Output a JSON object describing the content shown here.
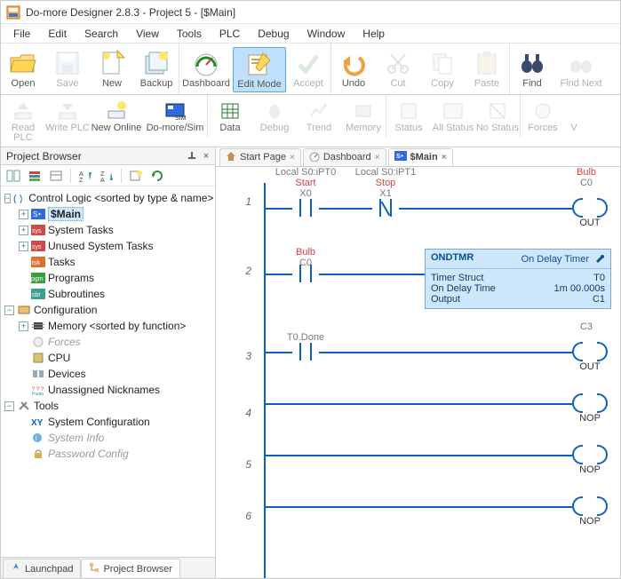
{
  "colors": {
    "accent": "#1060c0",
    "active_tab_bg": "#bfe0ff"
  },
  "titlebar": {
    "title": "Do-more Designer 2.8.3 - Project 5 - [$Main]"
  },
  "menu": {
    "items": [
      "File",
      "Edit",
      "Search",
      "View",
      "Tools",
      "PLC",
      "Debug",
      "Window",
      "Help"
    ]
  },
  "toolbar1": {
    "groups": [
      {
        "items": [
          {
            "id": "open",
            "label": "Open"
          },
          {
            "id": "save",
            "label": "Save",
            "disabled": true
          },
          {
            "id": "new",
            "label": "New"
          },
          {
            "id": "backup",
            "label": "Backup"
          }
        ]
      },
      {
        "items": [
          {
            "id": "dashboard",
            "label": "Dashboard"
          },
          {
            "id": "editmode",
            "label": "Edit Mode",
            "active": true
          },
          {
            "id": "accept",
            "label": "Accept",
            "disabled": true
          }
        ]
      },
      {
        "items": [
          {
            "id": "undo",
            "label": "Undo"
          },
          {
            "id": "cut",
            "label": "Cut",
            "disabled": true
          },
          {
            "id": "copy",
            "label": "Copy",
            "disabled": true
          },
          {
            "id": "paste",
            "label": "Paste",
            "disabled": true
          }
        ]
      },
      {
        "items": [
          {
            "id": "find",
            "label": "Find"
          },
          {
            "id": "findnext",
            "label": "Find Next",
            "disabled": true
          }
        ]
      }
    ]
  },
  "toolbar2": {
    "groups": [
      {
        "items": [
          {
            "id": "readplc",
            "label": "Read PLC",
            "disabled": true
          },
          {
            "id": "writeplc",
            "label": "Write PLC",
            "disabled": true
          },
          {
            "id": "newonline",
            "label": "New Online"
          },
          {
            "id": "domoresim",
            "label": "Do-more/Sim"
          }
        ]
      },
      {
        "items": [
          {
            "id": "data",
            "label": "Data"
          },
          {
            "id": "debug",
            "label": "Debug",
            "disabled": true
          },
          {
            "id": "trend",
            "label": "Trend",
            "disabled": true
          },
          {
            "id": "memory",
            "label": "Memory",
            "disabled": true
          }
        ]
      },
      {
        "items": [
          {
            "id": "status",
            "label": "Status",
            "disabled": true
          },
          {
            "id": "allstatus",
            "label": "All Status",
            "disabled": true
          },
          {
            "id": "nostatus",
            "label": "No Status",
            "disabled": true
          }
        ]
      },
      {
        "items": [
          {
            "id": "forces",
            "label": "Forces",
            "disabled": true
          },
          {
            "id": "value",
            "label": "V",
            "disabled": true
          }
        ]
      }
    ]
  },
  "sidebar": {
    "title": "Project Browser",
    "closeGlyph": "×",
    "pinGlyph": "⟂",
    "tree": {
      "root1": {
        "label": "Control Logic <sorted by type & name>",
        "children": {
          "main": {
            "icon": "smain",
            "label": "$Main",
            "selected": true
          },
          "systasks": {
            "icon": "sys",
            "label": "System Tasks",
            "children": true
          },
          "unsystasks": {
            "icon": "sys",
            "label": "Unused System Tasks",
            "children": true
          },
          "tasks": {
            "icon": "tsk",
            "label": "Tasks"
          },
          "programs": {
            "icon": "pgm",
            "label": "Programs"
          },
          "subr": {
            "icon": "sbr",
            "label": "Subroutines"
          }
        }
      },
      "root2": {
        "label": "Configuration",
        "children": {
          "memory": {
            "icon": "mem",
            "label": "Memory <sorted by function>",
            "children": true
          },
          "forces": {
            "icon": "forces",
            "label": "Forces",
            "dim": true
          },
          "cpu": {
            "icon": "cpu",
            "label": "CPU"
          },
          "devices": {
            "icon": "dev",
            "label": "Devices"
          },
          "unnick": {
            "icon": "nick",
            "label": "Unassigned Nicknames"
          }
        }
      },
      "root3": {
        "label": "Tools",
        "children": {
          "sysconfig": {
            "icon": "xy",
            "label": "System Configuration"
          },
          "sysinfo": {
            "icon": "info",
            "label": "System Info",
            "dim": true
          },
          "pwdcfg": {
            "icon": "lock",
            "label": "Password Config",
            "dim": true
          }
        }
      }
    },
    "bottom_tabs": [
      {
        "id": "launchpad",
        "label": "Launchpad"
      },
      {
        "id": "projectbrowser",
        "label": "Project Browser",
        "active": true
      }
    ]
  },
  "doctabs": [
    {
      "id": "startpage",
      "label": "Start Page",
      "icon": "home"
    },
    {
      "id": "dashboard",
      "label": "Dashboard",
      "icon": "dash"
    },
    {
      "id": "main",
      "label": "$Main",
      "icon": "smain",
      "active": true
    }
  ],
  "ladder": {
    "rungs": [
      {
        "num": "1",
        "cols": [
          {
            "header": "Local S0:iPT0",
            "nickname": "Start",
            "addr": "X0",
            "type": "no"
          },
          {
            "header": "Local S0:iPT1",
            "nickname": "Stop",
            "addr": "X1",
            "type": "nc"
          }
        ],
        "out": {
          "nickname": "Bulb",
          "addr": "C0",
          "type": "coil",
          "text": "OUT"
        }
      },
      {
        "num": "2",
        "cols": [
          {
            "header": "",
            "nickname": "Bulb",
            "addr": "C0",
            "type": "no"
          }
        ],
        "box": {
          "name": "ONDTMR",
          "desc": "On Delay Timer",
          "rows": [
            {
              "k": "Timer Struct",
              "v": "T0"
            },
            {
              "k": "On Delay Time",
              "v": "1m 00.000s"
            },
            {
              "k": "Output",
              "v": "C1"
            }
          ]
        }
      },
      {
        "num": "3",
        "cols": [
          {
            "header": "",
            "nickname": "",
            "addr": "T0.Done",
            "type": "no"
          }
        ],
        "out": {
          "nickname": "",
          "addr": "C3",
          "type": "coil",
          "text": "OUT"
        }
      },
      {
        "num": "4",
        "cols": [],
        "out": {
          "type": "coil",
          "text": "NOP"
        }
      },
      {
        "num": "5",
        "cols": [],
        "out": {
          "type": "coil",
          "text": "NOP"
        }
      },
      {
        "num": "6",
        "cols": [],
        "out": {
          "type": "coil",
          "text": "NOP"
        }
      }
    ]
  }
}
